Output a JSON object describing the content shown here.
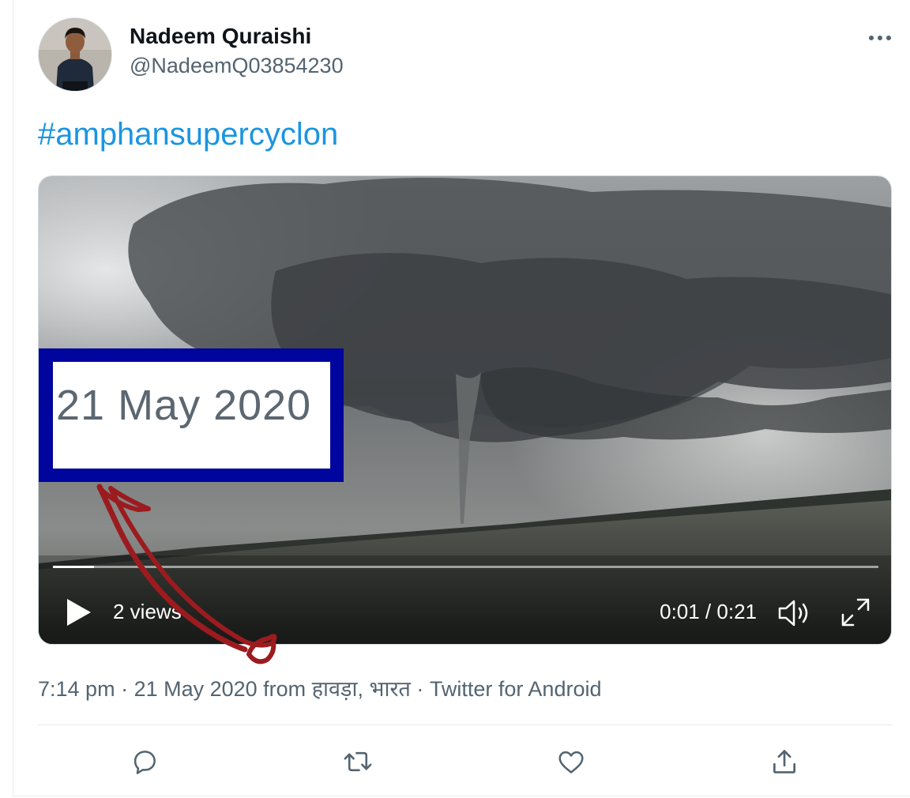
{
  "tweet": {
    "display_name": "Nadeem Quraishi",
    "handle": "@NadeemQ03854230",
    "text": "#amphansupercyclon"
  },
  "video": {
    "views": "2 views",
    "time": "0:01 / 0:21",
    "progress_fraction": 0.05
  },
  "overlay": {
    "date_label": "21 May 2020"
  },
  "meta": {
    "time": "7:14 pm",
    "sep1": " · ",
    "date": "21 May 2020",
    "from_text": " from ",
    "location": "हावड़ा, भारत",
    "sep2": " · ",
    "source": "Twitter for Android"
  },
  "icons": [
    "more-icon",
    "play-icon",
    "volume-icon",
    "fullscreen-icon",
    "reply-icon",
    "retweet-icon",
    "like-icon",
    "share-icon"
  ],
  "colors": {
    "link": "#1b95e0",
    "secondary_text": "#536471",
    "highlight_box": "#00059e",
    "arrow": "#9b1b1f"
  }
}
